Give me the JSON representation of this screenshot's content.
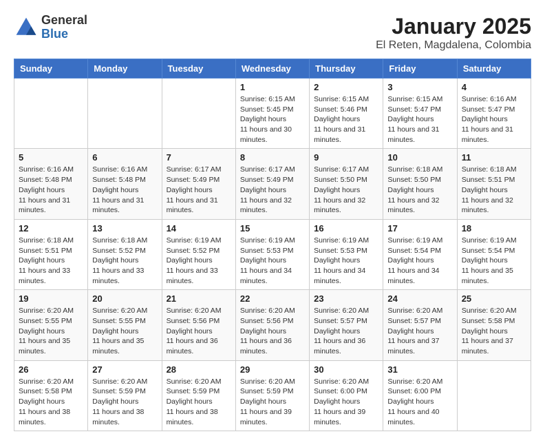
{
  "header": {
    "logo_general": "General",
    "logo_blue": "Blue",
    "month_title": "January 2025",
    "location": "El Reten, Magdalena, Colombia"
  },
  "days_of_week": [
    "Sunday",
    "Monday",
    "Tuesday",
    "Wednesday",
    "Thursday",
    "Friday",
    "Saturday"
  ],
  "weeks": [
    [
      {
        "day": "",
        "info": ""
      },
      {
        "day": "",
        "info": ""
      },
      {
        "day": "",
        "info": ""
      },
      {
        "day": "1",
        "sunrise": "6:15 AM",
        "sunset": "5:45 PM",
        "daylight": "11 hours and 30 minutes."
      },
      {
        "day": "2",
        "sunrise": "6:15 AM",
        "sunset": "5:46 PM",
        "daylight": "11 hours and 31 minutes."
      },
      {
        "day": "3",
        "sunrise": "6:15 AM",
        "sunset": "5:47 PM",
        "daylight": "11 hours and 31 minutes."
      },
      {
        "day": "4",
        "sunrise": "6:16 AM",
        "sunset": "5:47 PM",
        "daylight": "11 hours and 31 minutes."
      }
    ],
    [
      {
        "day": "5",
        "sunrise": "6:16 AM",
        "sunset": "5:48 PM",
        "daylight": "11 hours and 31 minutes."
      },
      {
        "day": "6",
        "sunrise": "6:16 AM",
        "sunset": "5:48 PM",
        "daylight": "11 hours and 31 minutes."
      },
      {
        "day": "7",
        "sunrise": "6:17 AM",
        "sunset": "5:49 PM",
        "daylight": "11 hours and 31 minutes."
      },
      {
        "day": "8",
        "sunrise": "6:17 AM",
        "sunset": "5:49 PM",
        "daylight": "11 hours and 32 minutes."
      },
      {
        "day": "9",
        "sunrise": "6:17 AM",
        "sunset": "5:50 PM",
        "daylight": "11 hours and 32 minutes."
      },
      {
        "day": "10",
        "sunrise": "6:18 AM",
        "sunset": "5:50 PM",
        "daylight": "11 hours and 32 minutes."
      },
      {
        "day": "11",
        "sunrise": "6:18 AM",
        "sunset": "5:51 PM",
        "daylight": "11 hours and 32 minutes."
      }
    ],
    [
      {
        "day": "12",
        "sunrise": "6:18 AM",
        "sunset": "5:51 PM",
        "daylight": "11 hours and 33 minutes."
      },
      {
        "day": "13",
        "sunrise": "6:18 AM",
        "sunset": "5:52 PM",
        "daylight": "11 hours and 33 minutes."
      },
      {
        "day": "14",
        "sunrise": "6:19 AM",
        "sunset": "5:52 PM",
        "daylight": "11 hours and 33 minutes."
      },
      {
        "day": "15",
        "sunrise": "6:19 AM",
        "sunset": "5:53 PM",
        "daylight": "11 hours and 34 minutes."
      },
      {
        "day": "16",
        "sunrise": "6:19 AM",
        "sunset": "5:53 PM",
        "daylight": "11 hours and 34 minutes."
      },
      {
        "day": "17",
        "sunrise": "6:19 AM",
        "sunset": "5:54 PM",
        "daylight": "11 hours and 34 minutes."
      },
      {
        "day": "18",
        "sunrise": "6:19 AM",
        "sunset": "5:54 PM",
        "daylight": "11 hours and 35 minutes."
      }
    ],
    [
      {
        "day": "19",
        "sunrise": "6:20 AM",
        "sunset": "5:55 PM",
        "daylight": "11 hours and 35 minutes."
      },
      {
        "day": "20",
        "sunrise": "6:20 AM",
        "sunset": "5:55 PM",
        "daylight": "11 hours and 35 minutes."
      },
      {
        "day": "21",
        "sunrise": "6:20 AM",
        "sunset": "5:56 PM",
        "daylight": "11 hours and 36 minutes."
      },
      {
        "day": "22",
        "sunrise": "6:20 AM",
        "sunset": "5:56 PM",
        "daylight": "11 hours and 36 minutes."
      },
      {
        "day": "23",
        "sunrise": "6:20 AM",
        "sunset": "5:57 PM",
        "daylight": "11 hours and 36 minutes."
      },
      {
        "day": "24",
        "sunrise": "6:20 AM",
        "sunset": "5:57 PM",
        "daylight": "11 hours and 37 minutes."
      },
      {
        "day": "25",
        "sunrise": "6:20 AM",
        "sunset": "5:58 PM",
        "daylight": "11 hours and 37 minutes."
      }
    ],
    [
      {
        "day": "26",
        "sunrise": "6:20 AM",
        "sunset": "5:58 PM",
        "daylight": "11 hours and 38 minutes."
      },
      {
        "day": "27",
        "sunrise": "6:20 AM",
        "sunset": "5:59 PM",
        "daylight": "11 hours and 38 minutes."
      },
      {
        "day": "28",
        "sunrise": "6:20 AM",
        "sunset": "5:59 PM",
        "daylight": "11 hours and 38 minutes."
      },
      {
        "day": "29",
        "sunrise": "6:20 AM",
        "sunset": "5:59 PM",
        "daylight": "11 hours and 39 minutes."
      },
      {
        "day": "30",
        "sunrise": "6:20 AM",
        "sunset": "6:00 PM",
        "daylight": "11 hours and 39 minutes."
      },
      {
        "day": "31",
        "sunrise": "6:20 AM",
        "sunset": "6:00 PM",
        "daylight": "11 hours and 40 minutes."
      },
      {
        "day": "",
        "info": ""
      }
    ]
  ]
}
